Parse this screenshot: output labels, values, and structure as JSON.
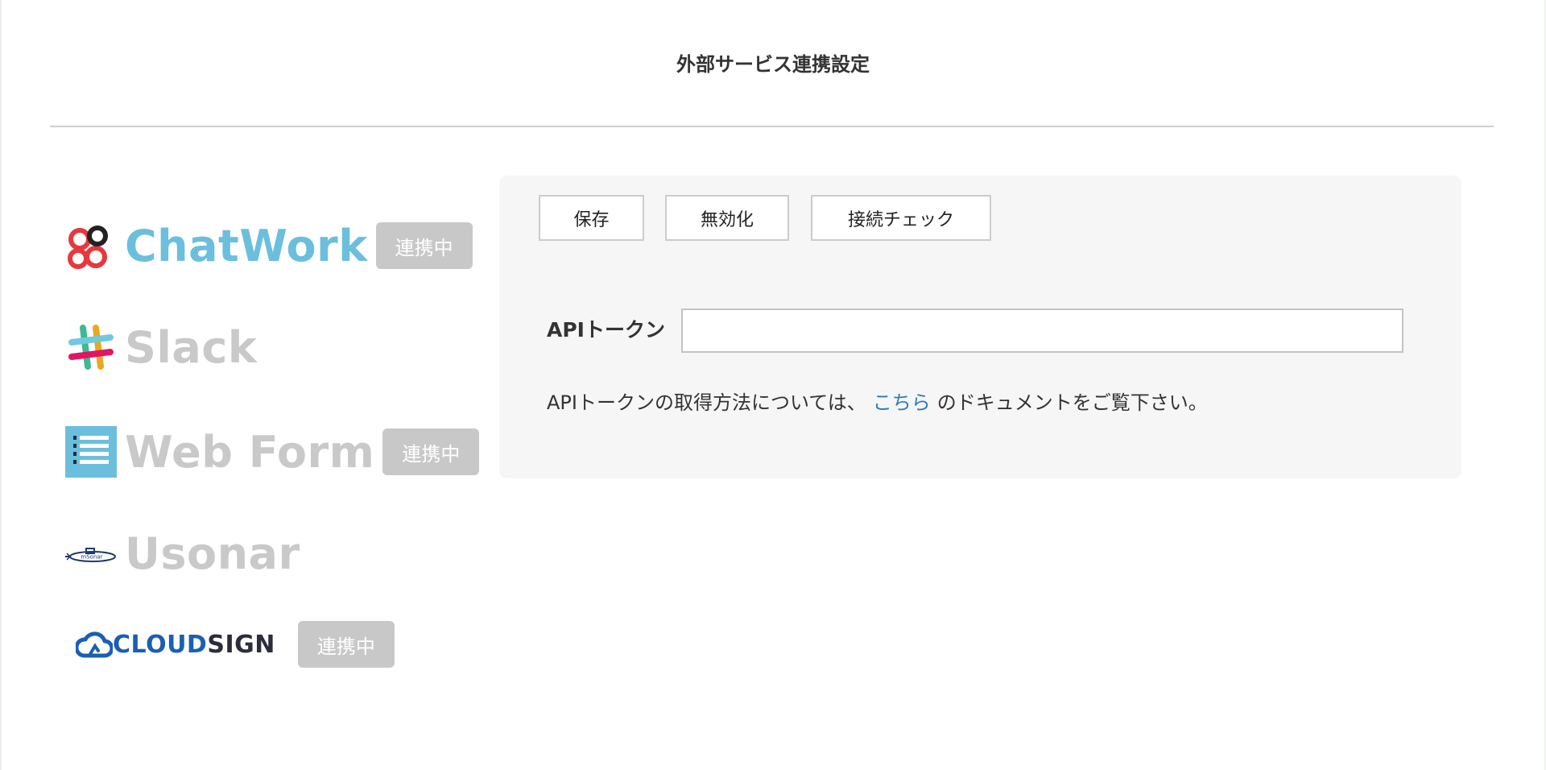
{
  "page": {
    "title": "外部サービス連携設定"
  },
  "services": [
    {
      "name": "ChatWork",
      "status": "連携中",
      "active": true,
      "icon": "chatwork-logo-icon"
    },
    {
      "name": "Slack",
      "status": "",
      "active": false,
      "icon": "slack-logo-icon"
    },
    {
      "name": "Web Form",
      "status": "連携中",
      "active": false,
      "icon": "web-form-list-icon"
    },
    {
      "name": "Usonar",
      "status": "",
      "active": false,
      "icon": "usonar-submarine-icon"
    },
    {
      "name": "CLOUDSIGN",
      "name_part1": "CLOUD",
      "name_part2": "SIGN",
      "status": "連携中",
      "active": false,
      "icon": "cloudsign-cloud-icon"
    }
  ],
  "panel": {
    "buttons": {
      "save": "保存",
      "disable": "無効化",
      "check": "接続チェック"
    },
    "token_label": "APIトークン",
    "token_value": "",
    "help_prefix": "APIトークンの取得方法については、",
    "help_link": "こちら",
    "help_suffix": "のドキュメントをご覧下さい。"
  },
  "colors": {
    "active_service": "#6bbfdc",
    "inactive_service": "#c9c9c9",
    "badge_bg": "#c8c8c8",
    "link": "#2c7fb8",
    "panel_bg": "#f6f6f6"
  }
}
